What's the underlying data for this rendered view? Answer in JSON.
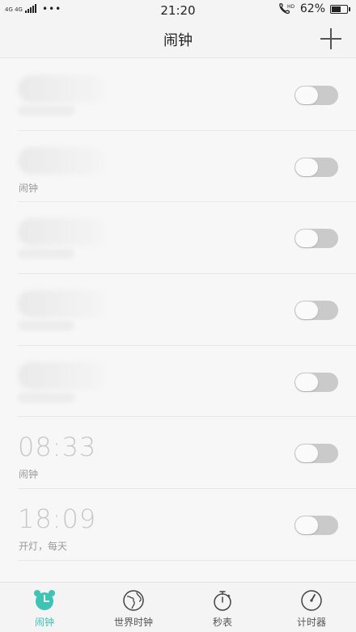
{
  "status_bar": {
    "network": "4G 4G",
    "dots": "•••",
    "time": "21:20",
    "call_icon": "phone-hd-icon",
    "battery_percent_text": "62%",
    "battery_level": 0.62
  },
  "header": {
    "title": "闹钟",
    "add_icon": "plus-icon"
  },
  "alarms": [
    {
      "time": "",
      "label": "",
      "enabled": false
    },
    {
      "time": "",
      "label": "闹钟",
      "enabled": false
    },
    {
      "time": "",
      "label": "",
      "enabled": false
    },
    {
      "time": "",
      "label": "",
      "enabled": false
    },
    {
      "time": "",
      "label": "",
      "enabled": false
    },
    {
      "time": "08:33",
      "label": "闹钟",
      "enabled": false
    },
    {
      "time": "18:09",
      "label": "开灯，每天",
      "enabled": false
    }
  ],
  "tabs": [
    {
      "label": "闹钟",
      "icon": "alarm-clock-icon",
      "active": true
    },
    {
      "label": "世界时钟",
      "icon": "globe-icon",
      "active": false
    },
    {
      "label": "秒表",
      "icon": "stopwatch-icon",
      "active": false
    },
    {
      "label": "计时器",
      "icon": "timer-icon",
      "active": false
    }
  ],
  "colors": {
    "accent": "#3cc4b4",
    "toggle_off": "#cacaca"
  }
}
